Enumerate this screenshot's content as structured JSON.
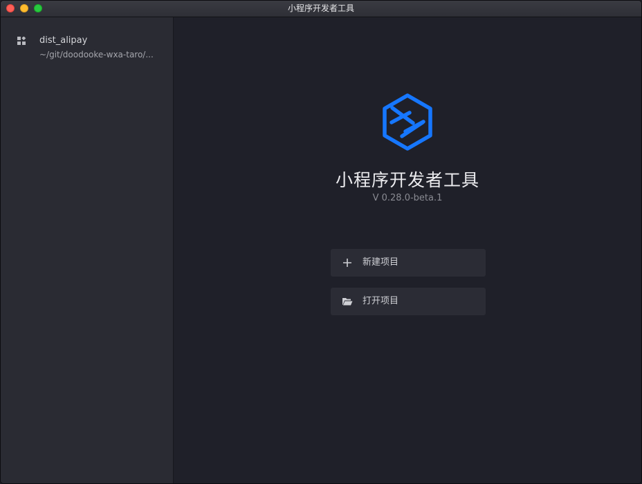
{
  "window": {
    "title": "小程序开发者工具"
  },
  "sidebar": {
    "projects": [
      {
        "name": "dist_alipay",
        "path": "~/git/doodooke-wxa-taro/...",
        "icon": "grid-icon"
      }
    ]
  },
  "welcome": {
    "app_name": "小程序开发者工具",
    "version": "V 0.28.0-beta.1",
    "logo_color": "#1677ff",
    "actions": {
      "new_project": {
        "label": "新建项目",
        "icon": "plus-icon"
      },
      "open_project": {
        "label": "打开项目",
        "icon": "folder-open-icon"
      }
    }
  }
}
